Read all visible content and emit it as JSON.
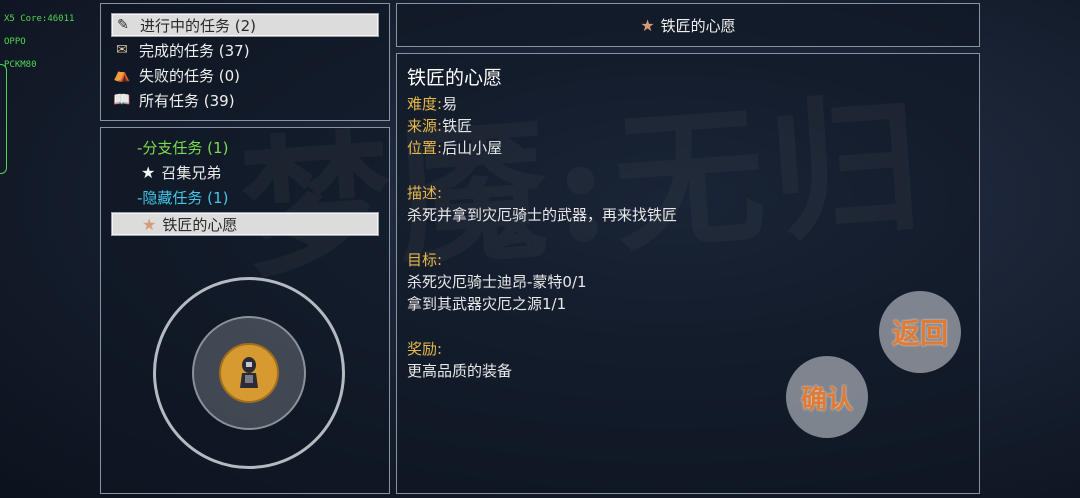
{
  "debug": {
    "core": "X5 Core:46011",
    "brand": "OPPO",
    "model": "PCKM80"
  },
  "watermark": "梦魇:无归",
  "categories": [
    {
      "label": "进行中的任务 (2)",
      "icon": "scroll-ticket-icon",
      "glyph": "✎",
      "selected": true
    },
    {
      "label": "完成的任务 (37)",
      "icon": "scroll-icon",
      "glyph": "✉",
      "selected": false
    },
    {
      "label": "失败的任务 (0)",
      "icon": "tent-icon",
      "glyph": "⛺",
      "selected": false
    },
    {
      "label": "所有任务 (39)",
      "icon": "book-icon",
      "glyph": "📖",
      "selected": false
    }
  ],
  "tree": {
    "branch_header": "-分支任务 (1)",
    "branch_item": "召集兄弟",
    "hidden_header": "-隐藏任务 (1)",
    "hidden_item": "铁匠的心愿"
  },
  "header": {
    "title": "铁匠的心愿"
  },
  "detail": {
    "title": "铁匠的心愿",
    "difficulty_label": "难度:",
    "difficulty_value": "易",
    "source_label": "来源:",
    "source_value": "铁匠",
    "location_label": "位置:",
    "location_value": "后山小屋",
    "desc_label": "描述:",
    "desc_text": "杀死并拿到灾厄骑士的武器，再来找铁匠",
    "goal_label": "目标:",
    "goal_1": "杀死灾厄骑士迪昂-蒙特0/1",
    "goal_2": "拿到其武器灾厄之源1/1",
    "reward_label": "奖励:",
    "reward_text": "更高品质的装备"
  },
  "buttons": {
    "back": "返回",
    "confirm": "确认"
  },
  "colors": {
    "accent_orange": "#e07a35",
    "branch_green": "#7bdc4f",
    "hidden_cyan": "#44c6e8",
    "label_yellow": "#e6b84a"
  }
}
